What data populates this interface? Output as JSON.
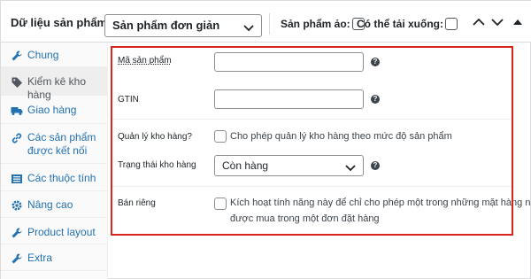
{
  "header": {
    "title": "Dữ liệu sản phẩm —",
    "product_type": "Sản phẩm đơn giản",
    "virtual_label": "Sản phẩm ảo:",
    "downloadable_label": "Có thể tải xuống:"
  },
  "sidebar": {
    "items": [
      {
        "label": "Chung",
        "icon": "wrench-icon"
      },
      {
        "label": "Kiểm kê kho hàng",
        "icon": "tag-icon",
        "active": true
      },
      {
        "label": "Giao hàng",
        "icon": "truck-icon"
      },
      {
        "label": "Các sản phẩm được kết nối",
        "icon": "link-icon"
      },
      {
        "label": "Các thuộc tính",
        "icon": "list-icon"
      },
      {
        "label": "Nâng cao",
        "icon": "gear-icon"
      },
      {
        "label": "Product layout",
        "icon": "wrench-icon"
      },
      {
        "label": "Extra",
        "icon": "wrench-icon"
      }
    ]
  },
  "inventory": {
    "sku_label": "Mã sản phẩm",
    "sku_value": "",
    "gtin_label": "GTIN",
    "gtin_value": "",
    "manage_stock_label": "Quản lý kho hàng?",
    "manage_stock_desc": "Cho phép quản lý kho hàng theo mức độ sản phẩm",
    "stock_status_label": "Trạng thái kho hàng",
    "stock_status_value": "Còn hàng",
    "sold_individually_label": "Bán riêng",
    "sold_individually_desc_1": "Kích hoạt tính năng này để chỉ cho phép một trong những mặt hàng này",
    "sold_individually_desc_2": "được mua trong một đơn đặt hàng"
  },
  "colors": {
    "link": "#2271b1",
    "highlight_border": "#d9261c"
  }
}
